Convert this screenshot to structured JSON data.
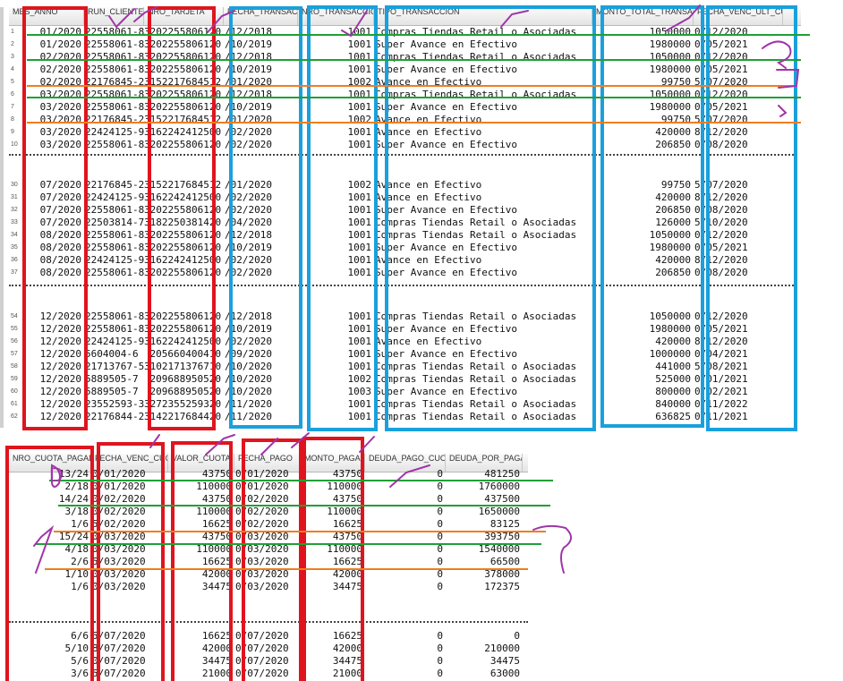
{
  "top_grid": {
    "headers": [
      "MES_ANNO",
      "RUN_CLIENTE",
      "NRO_TARJETA",
      "FECHA_TRANSACCION",
      "NRO_TRANSACCION",
      "TIPO_TRANSACCION",
      "MONTO_TOTAL_TRANSACCION",
      "FECHA_VENC_ULT_CUOTA"
    ],
    "groups": [
      {
        "rows": [
          {
            "n": "1",
            "c": [
              "01/2020",
              "22558061-8",
              "3202255806120",
              "/12/2018",
              "1001",
              "Compras Tiendas Retail o Asociadas",
              "1050000",
              "0/12/2020"
            ]
          },
          {
            "n": "2",
            "c": [
              "01/2020",
              "22558061-8",
              "3202255806120",
              "/10/2019",
              "1001",
              "Super Avance en Efectivo",
              "1980000",
              "0/05/2021"
            ]
          },
          {
            "n": "3",
            "c": [
              "02/2020",
              "22558061-8",
              "3202255806120",
              "/12/2018",
              "1001",
              "Compras Tiendas Retail o Asociadas",
              "1050000",
              "0/12/2020"
            ]
          },
          {
            "n": "4",
            "c": [
              "02/2020",
              "22558061-8",
              "3202255806120",
              "/10/2019",
              "1001",
              "Super Avance en Efectivo",
              "1980000",
              "0/05/2021"
            ]
          },
          {
            "n": "5",
            "c": [
              "02/2020",
              "22176845-2",
              "3152217684512",
              "/01/2020",
              "1002",
              "Avance en Efectivo",
              "99750",
              "5/07/2020"
            ]
          },
          {
            "n": "6",
            "c": [
              "03/2020",
              "22558061-8",
              "3202255806120",
              "/12/2018",
              "1001",
              "Compras Tiendas Retail o Asociadas",
              "1050000",
              "0/12/2020"
            ]
          },
          {
            "n": "7",
            "c": [
              "03/2020",
              "22558061-8",
              "3202255806120",
              "/10/2019",
              "1001",
              "Super Avance en Efectivo",
              "1980000",
              "0/05/2021"
            ]
          },
          {
            "n": "8",
            "c": [
              "03/2020",
              "22176845-2",
              "3152217684512",
              "/01/2020",
              "1002",
              "Avance en Efectivo",
              "99750",
              "5/07/2020"
            ]
          },
          {
            "n": "9",
            "c": [
              "03/2020",
              "22424125-9",
              "3162242412500",
              "/02/2020",
              "1001",
              "Avance en Efectivo",
              "420000",
              "8/12/2020"
            ]
          },
          {
            "n": "10",
            "c": [
              "03/2020",
              "22558061-8",
              "3202255806120",
              "/02/2020",
              "1001",
              "Super Avance en Efectivo",
              "206850",
              "0/08/2020"
            ]
          }
        ]
      },
      {
        "rows": [
          {
            "n": "30",
            "c": [
              "07/2020",
              "22176845-2",
              "3152217684512",
              "/01/2020",
              "1002",
              "Avance en Efectivo",
              "99750",
              "5/07/2020"
            ]
          },
          {
            "n": "31",
            "c": [
              "07/2020",
              "22424125-9",
              "3162242412500",
              "/02/2020",
              "1001",
              "Avance en Efectivo",
              "420000",
              "8/12/2020"
            ]
          },
          {
            "n": "32",
            "c": [
              "07/2020",
              "22558061-8",
              "3202255806120",
              "/02/2020",
              "1001",
              "Super Avance en Efectivo",
              "206850",
              "0/08/2020"
            ]
          },
          {
            "n": "33",
            "c": [
              "07/2020",
              "22503814-7",
              "3182250381420",
              "/04/2020",
              "1001",
              "Compras Tiendas Retail o Asociadas",
              "126000",
              "5/10/2020"
            ]
          },
          {
            "n": "34",
            "c": [
              "08/2020",
              "22558061-8",
              "3202255806120",
              "/12/2018",
              "1001",
              "Compras Tiendas Retail o Asociadas",
              "1050000",
              "0/12/2020"
            ]
          },
          {
            "n": "35",
            "c": [
              "08/2020",
              "22558061-8",
              "3202255806120",
              "/10/2019",
              "1001",
              "Super Avance en Efectivo",
              "1980000",
              "0/05/2021"
            ]
          },
          {
            "n": "36",
            "c": [
              "08/2020",
              "22424125-9",
              "3162242412500",
              "/02/2020",
              "1001",
              "Avance en Efectivo",
              "420000",
              "8/12/2020"
            ]
          },
          {
            "n": "37",
            "c": [
              "08/2020",
              "22558061-8",
              "3202255806120",
              "/02/2020",
              "1001",
              "Super Avance en Efectivo",
              "206850",
              "0/08/2020"
            ]
          }
        ]
      },
      {
        "rows": [
          {
            "n": "54",
            "c": [
              "12/2020",
              "22558061-8",
              "3202255806120",
              "/12/2018",
              "1001",
              "Compras Tiendas Retail o Asociadas",
              "1050000",
              "0/12/2020"
            ]
          },
          {
            "n": "55",
            "c": [
              "12/2020",
              "22558061-8",
              "3202255806120",
              "/10/2019",
              "1001",
              "Super Avance en Efectivo",
              "1980000",
              "0/05/2021"
            ]
          },
          {
            "n": "56",
            "c": [
              "12/2020",
              "22424125-9",
              "3162242412500",
              "/02/2020",
              "1001",
              "Avance en Efectivo",
              "420000",
              "8/12/2020"
            ]
          },
          {
            "n": "57",
            "c": [
              "12/2020",
              "5604004-6",
              "205660400410",
              "/09/2020",
              "1001",
              "Super Avance en Efectivo",
              "1000000",
              "0/04/2021"
            ]
          },
          {
            "n": "58",
            "c": [
              "12/2020",
              "21713767-5",
              "3102171376710",
              "/10/2020",
              "1001",
              "Compras Tiendas Retail o Asociadas",
              "441000",
              "5/08/2021"
            ]
          },
          {
            "n": "59",
            "c": [
              "12/2020",
              "5889505-7",
              "209688950520",
              "/10/2020",
              "1002",
              "Compras Tiendas Retail o Asociadas",
              "525000",
              "0/01/2021"
            ]
          },
          {
            "n": "60",
            "c": [
              "12/2020",
              "5889505-7",
              "209688950520",
              "/10/2020",
              "1003",
              "Super Avance en Efectivo",
              "800000",
              "0/02/2021"
            ]
          },
          {
            "n": "61",
            "c": [
              "12/2020",
              "23552593-3",
              "3272355259320",
              "/11/2020",
              "1001",
              "Compras Tiendas Retail o Asociadas",
              "840000",
              "0/11/2022"
            ]
          },
          {
            "n": "62",
            "c": [
              "12/2020",
              "22176844-2",
              "3142217684420",
              "/11/2020",
              "1001",
              "Compras Tiendas Retail o Asociadas",
              "636825",
              "0/11/2021"
            ]
          }
        ]
      }
    ]
  },
  "bottom_grid": {
    "headers": [
      "NRO_CUOTA_PAGADA",
      "FECHA_VENC_CUOTA",
      "VALOR_CUOTA",
      "FECHA_PAGO",
      "MONTO_PAGADO",
      "DEUDA_PAGO_CUOTA",
      "DEUDA_POR_PAGAR"
    ],
    "groups": [
      {
        "rows": [
          {
            "c": [
              "13/24",
              "0/01/2020",
              "43750",
              "0/01/2020",
              "43750",
              "0",
              "481250"
            ]
          },
          {
            "c": [
              "2/18",
              "0/01/2020",
              "110000",
              "0/01/2020",
              "110000",
              "0",
              "1760000"
            ]
          },
          {
            "c": [
              "14/24",
              "0/02/2020",
              "43750",
              "0/02/2020",
              "43750",
              "0",
              "437500"
            ]
          },
          {
            "c": [
              "3/18",
              "0/02/2020",
              "110000",
              "0/02/2020",
              "110000",
              "0",
              "1650000"
            ]
          },
          {
            "c": [
              "1/6",
              "5/02/2020",
              "16625",
              "0/02/2020",
              "16625",
              "0",
              "83125"
            ]
          },
          {
            "c": [
              "15/24",
              "0/03/2020",
              "43750",
              "0/03/2020",
              "43750",
              "0",
              "393750"
            ]
          },
          {
            "c": [
              "4/18",
              "0/03/2020",
              "110000",
              "0/03/2020",
              "110000",
              "0",
              "1540000"
            ]
          },
          {
            "c": [
              "2/6",
              "5/03/2020",
              "16625",
              "0/03/2020",
              "16625",
              "0",
              "66500"
            ]
          },
          {
            "c": [
              "1/10",
              "0/03/2020",
              "42000",
              "0/03/2020",
              "42000",
              "0",
              "378000"
            ]
          },
          {
            "c": [
              "1/6",
              "0/03/2020",
              "34475",
              "0/03/2020",
              "34475",
              "0",
              "172375"
            ]
          }
        ]
      },
      {
        "rows": [
          {
            "c": [
              "6/6",
              "5/07/2020",
              "16625",
              "0/07/2020",
              "16625",
              "0",
              "0"
            ]
          },
          {
            "c": [
              "5/10",
              "8/07/2020",
              "42000",
              "0/07/2020",
              "42000",
              "0",
              "210000"
            ]
          },
          {
            "c": [
              "5/6",
              "0/07/2020",
              "34475",
              "0/07/2020",
              "34475",
              "0",
              "34475"
            ]
          },
          {
            "c": [
              "3/6",
              "5/07/2020",
              "21000",
              "0/07/2020",
              "21000",
              "0",
              "63000"
            ]
          }
        ]
      }
    ]
  },
  "annotations": {
    "label_d": "D",
    "colors": {
      "red": "#e0141e",
      "blue": "#1aa0dc",
      "green": "#1fa035",
      "orange": "#ef7d22",
      "purple": "#a035a8"
    }
  }
}
